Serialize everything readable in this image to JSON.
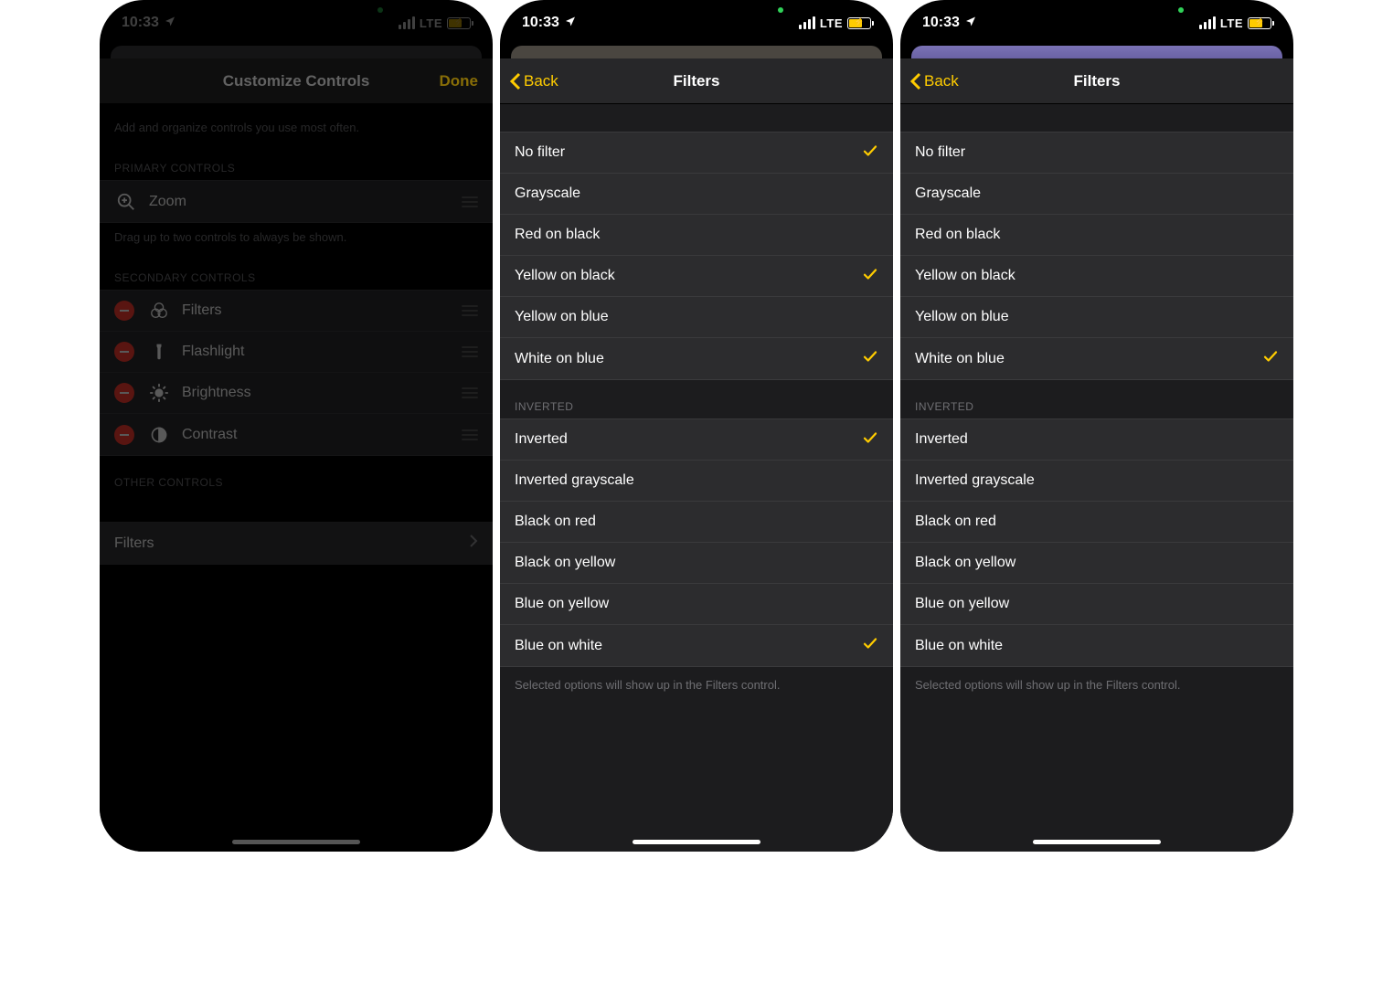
{
  "status": {
    "time": "10:33",
    "network": "LTE"
  },
  "screen1": {
    "title": "Customize Controls",
    "done": "Done",
    "hint": "Add and organize controls you use most often.",
    "primaryHeader": "PRIMARY CONTROLS",
    "primary": [
      {
        "label": "Zoom"
      }
    ],
    "primaryHint": "Drag up to two controls to always be shown.",
    "secondaryHeader": "SECONDARY CONTROLS",
    "secondary": [
      {
        "label": "Filters"
      },
      {
        "label": "Flashlight"
      },
      {
        "label": "Brightness"
      },
      {
        "label": "Contrast"
      }
    ],
    "otherHeader": "OTHER CONTROLS",
    "other": [
      {
        "label": "Filters"
      }
    ]
  },
  "screen2": {
    "back": "Back",
    "title": "Filters",
    "group1": [
      {
        "label": "No filter",
        "checked": true
      },
      {
        "label": "Grayscale",
        "checked": false
      },
      {
        "label": "Red on black",
        "checked": false
      },
      {
        "label": "Yellow on black",
        "checked": true
      },
      {
        "label": "Yellow on blue",
        "checked": false
      },
      {
        "label": "White on blue",
        "checked": true
      }
    ],
    "invertedHeader": "INVERTED",
    "group2": [
      {
        "label": "Inverted",
        "checked": true
      },
      {
        "label": "Inverted grayscale",
        "checked": false
      },
      {
        "label": "Black on red",
        "checked": false
      },
      {
        "label": "Black on yellow",
        "checked": false
      },
      {
        "label": "Blue on yellow",
        "checked": false
      },
      {
        "label": "Blue on white",
        "checked": true
      }
    ],
    "footer": "Selected options will show up in the Filters control."
  },
  "screen3": {
    "back": "Back",
    "title": "Filters",
    "group1": [
      {
        "label": "No filter",
        "checked": false
      },
      {
        "label": "Grayscale",
        "checked": false
      },
      {
        "label": "Red on black",
        "checked": false
      },
      {
        "label": "Yellow on black",
        "checked": false
      },
      {
        "label": "Yellow on blue",
        "checked": false
      },
      {
        "label": "White on blue",
        "checked": true
      }
    ],
    "invertedHeader": "INVERTED",
    "group2": [
      {
        "label": "Inverted",
        "checked": false
      },
      {
        "label": "Inverted grayscale",
        "checked": false
      },
      {
        "label": "Black on red",
        "checked": false
      },
      {
        "label": "Black on yellow",
        "checked": false
      },
      {
        "label": "Blue on yellow",
        "checked": false
      },
      {
        "label": "Blue on white",
        "checked": false
      }
    ],
    "footer": "Selected options will show up in the Filters control."
  }
}
